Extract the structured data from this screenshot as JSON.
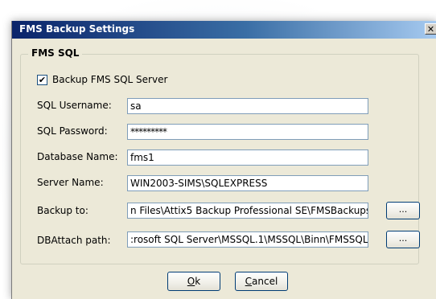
{
  "window": {
    "title": "FMS Backup Settings",
    "close_label": "✕"
  },
  "group": {
    "title": "FMS SQL"
  },
  "backup_checkbox": {
    "label": "Backup FMS SQL Server",
    "checked": true,
    "mark": "✔"
  },
  "fields": {
    "username": {
      "label": "SQL Username:",
      "value": "sa"
    },
    "password": {
      "label": "SQL Password:",
      "value": "*********"
    },
    "database": {
      "label": "Database Name:",
      "value": "fms1"
    },
    "server": {
      "label": "Server Name:",
      "value": "WIN2003-SIMS\\SQLEXPRESS"
    },
    "backup_to": {
      "label": "Backup to:",
      "value": "n Files\\Attix5 Backup Professional SE\\FMSBackups"
    },
    "dbattach": {
      "label": "DBAttach path:",
      "value": ":rosoft SQL Server\\MSSQL.1\\MSSQL\\Binn\\FMSSQL"
    }
  },
  "browse_label": "...",
  "buttons": {
    "ok": {
      "mnemonic": "O",
      "rest": "k"
    },
    "cancel": {
      "mnemonic": "C",
      "rest": "ancel"
    }
  }
}
